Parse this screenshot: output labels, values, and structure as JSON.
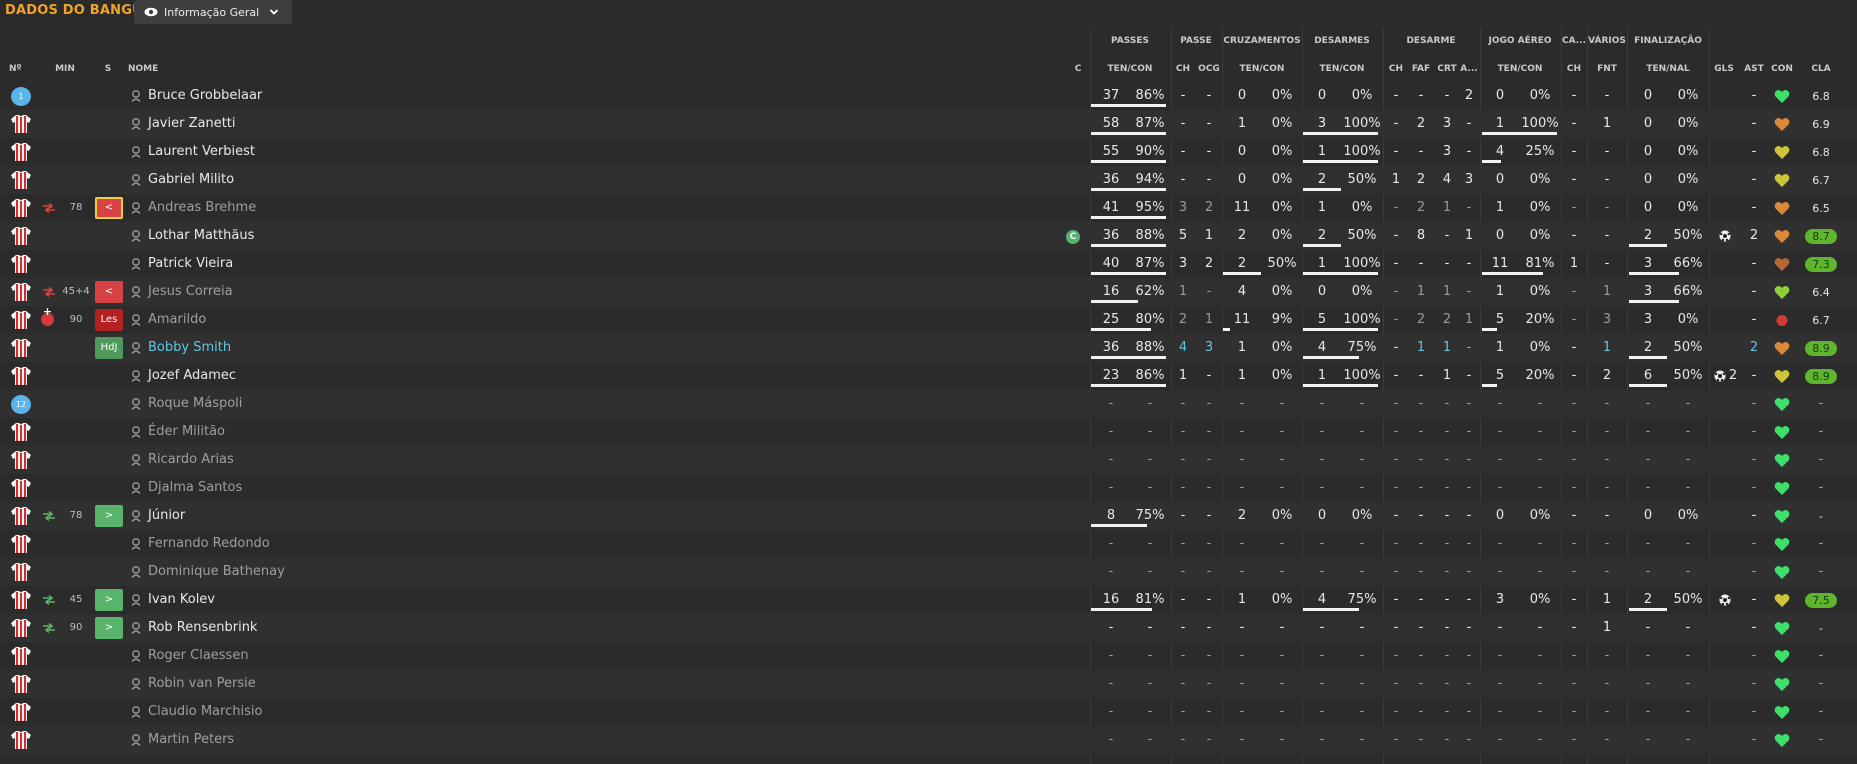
{
  "header": {
    "team_title": "DADOS DO BANGU",
    "view_label": "Informação Geral"
  },
  "columns": {
    "groups": {
      "passes": "PASSES",
      "passe": "PASSE",
      "cruzamentos": "CRUZAMENTOS",
      "desarmes": "DESARMES",
      "desarme": "DESARME",
      "jogo_aereo": "JOGO AÉREO",
      "ca": "CA...",
      "varios": "VÁRIOS",
      "finalizacao": "FINALIZAÇÃO"
    },
    "sub": {
      "num": "Nº",
      "min": "MIN",
      "s": "S",
      "nome": "NOME",
      "c": "C",
      "passes": "TEN/CON",
      "pch": "CH",
      "pocg": "OCG",
      "cruz": "TEN/CON",
      "des": "TEN/CON",
      "dch": "CH",
      "faf": "FAF",
      "crt": "CRT",
      "da": "A...",
      "aer": "TEN/CON",
      "cach": "CH",
      "fnt": "FNT",
      "fin": "TEN/NAL",
      "gls": "GLS",
      "ast": "AST",
      "con": "CON",
      "cla": "CLA"
    }
  },
  "colors": {
    "accent": "#f0a42a",
    "heart_green": "#3fe06a",
    "heart_orange": "#d88a3a",
    "heart_yellow": "#c9c63a",
    "heart_red": "#d33b3b",
    "rating_good": "#5fb52f"
  },
  "players": [
    {
      "name": "Bruce Grobbelaar",
      "gk": "1",
      "min": "",
      "badge": null,
      "sub": null,
      "cap": false,
      "dim": false,
      "hl": false,
      "p": [
        "37",
        "86%"
      ],
      "pch": "-",
      "pocg": "-",
      "cr": [
        "0",
        "0%"
      ],
      "de": [
        "0",
        "0%"
      ],
      "dch": "-",
      "faf": "-",
      "crt": "-",
      "da": "2",
      "ae": [
        "0",
        "0%"
      ],
      "cach": "-",
      "fnt": "-",
      "fi": [
        "0",
        "0%"
      ],
      "gls": "",
      "ast": "-",
      "con": "green",
      "cla": "6.8",
      "good": false,
      "pf": 1.0,
      "crf": 0,
      "def": 0,
      "aef": 0,
      "fif": 0
    },
    {
      "name": "Javier Zanetti",
      "gk": "",
      "min": "",
      "badge": null,
      "sub": null,
      "cap": false,
      "dim": false,
      "hl": false,
      "p": [
        "58",
        "87%"
      ],
      "pch": "-",
      "pocg": "-",
      "cr": [
        "1",
        "0%"
      ],
      "de": [
        "3",
        "100%"
      ],
      "dch": "-",
      "faf": "2",
      "crt": "3",
      "da": "-",
      "ae": [
        "1",
        "100%"
      ],
      "cach": "-",
      "fnt": "1",
      "fi": [
        "0",
        "0%"
      ],
      "gls": "",
      "ast": "-",
      "con": "orange",
      "cla": "6.9",
      "good": false,
      "pf": 1.0,
      "crf": 0,
      "def": 1,
      "aef": 1,
      "fif": 0
    },
    {
      "name": "Laurent Verbiest",
      "gk": "",
      "min": "",
      "badge": null,
      "sub": null,
      "cap": false,
      "dim": false,
      "hl": false,
      "p": [
        "55",
        "90%"
      ],
      "pch": "-",
      "pocg": "-",
      "cr": [
        "0",
        "0%"
      ],
      "de": [
        "1",
        "100%"
      ],
      "dch": "-",
      "faf": "-",
      "crt": "3",
      "da": "-",
      "ae": [
        "4",
        "25%"
      ],
      "cach": "-",
      "fnt": "-",
      "fi": [
        "0",
        "0%"
      ],
      "gls": "",
      "ast": "-",
      "con": "yellow",
      "cla": "6.8",
      "good": false,
      "pf": 1.0,
      "crf": 0,
      "def": 1,
      "aef": 0.25,
      "fif": 0
    },
    {
      "name": "Gabriel Milito",
      "gk": "",
      "min": "",
      "badge": null,
      "sub": null,
      "cap": false,
      "dim": false,
      "hl": false,
      "p": [
        "36",
        "94%"
      ],
      "pch": "-",
      "pocg": "-",
      "cr": [
        "0",
        "0%"
      ],
      "de": [
        "2",
        "50%"
      ],
      "dch": "1",
      "faf": "2",
      "crt": "4",
      "da": "3",
      "ae": [
        "0",
        "0%"
      ],
      "cach": "-",
      "fnt": "-",
      "fi": [
        "0",
        "0%"
      ],
      "gls": "",
      "ast": "-",
      "con": "yellow",
      "cla": "6.7",
      "good": false,
      "pf": 1.0,
      "crf": 0,
      "def": 0.5,
      "aef": 0,
      "fif": 0
    },
    {
      "name": "Andreas Brehme",
      "gk": "",
      "min": "78",
      "badge": "out-sel",
      "sub": "off",
      "cap": false,
      "dim": true,
      "hl": false,
      "p": [
        "41",
        "95%"
      ],
      "pch": "3",
      "pocg": "2",
      "cr": [
        "11",
        "0%"
      ],
      "de": [
        "1",
        "0%"
      ],
      "dch": "-",
      "faf": "2",
      "crt": "1",
      "da": "-",
      "ae": [
        "1",
        "0%"
      ],
      "cach": "-",
      "fnt": "-",
      "fi": [
        "0",
        "0%"
      ],
      "gls": "",
      "ast": "-",
      "con": "orange",
      "cla": "6.5",
      "good": false,
      "pf": 1.0,
      "crf": 0,
      "def": 0,
      "aef": 0,
      "fif": 0
    },
    {
      "name": "Lothar Matthäus",
      "gk": "",
      "min": "",
      "badge": null,
      "sub": null,
      "cap": true,
      "dim": false,
      "hl": false,
      "p": [
        "36",
        "88%"
      ],
      "pch": "5",
      "pocg": "1",
      "cr": [
        "2",
        "0%"
      ],
      "de": [
        "2",
        "50%"
      ],
      "dch": "-",
      "faf": "8",
      "crt": "-",
      "da": "1",
      "ae": [
        "0",
        "0%"
      ],
      "cach": "-",
      "fnt": "-",
      "fi": [
        "2",
        "50%"
      ],
      "gls": "ball",
      "ast": "2",
      "con": "orange",
      "cla": "8.7",
      "good": true,
      "pf": 1.0,
      "crf": 0,
      "def": 0.5,
      "aef": 0,
      "fif": 0.5
    },
    {
      "name": "Patrick Vieira",
      "gk": "",
      "min": "",
      "badge": null,
      "sub": null,
      "cap": false,
      "dim": false,
      "hl": false,
      "p": [
        "40",
        "87%"
      ],
      "pch": "3",
      "pocg": "2",
      "cr": [
        "2",
        "50%"
      ],
      "de": [
        "1",
        "100%"
      ],
      "dch": "-",
      "faf": "-",
      "crt": "-",
      "da": "-",
      "ae": [
        "11",
        "81%"
      ],
      "cach": "1",
      "fnt": "-",
      "fi": [
        "3",
        "66%"
      ],
      "gls": "",
      "ast": "-",
      "con": "brown",
      "cla": "7.3",
      "good": true,
      "pf": 1.0,
      "crf": 0.5,
      "def": 1,
      "aef": 0.81,
      "fif": 0.66
    },
    {
      "name": "Jesus Correia",
      "gk": "",
      "min": "45+4",
      "badge": "out",
      "sub": "off",
      "cap": false,
      "dim": true,
      "hl": false,
      "p": [
        "16",
        "62%"
      ],
      "pch": "1",
      "pocg": "-",
      "cr": [
        "4",
        "0%"
      ],
      "de": [
        "0",
        "0%"
      ],
      "dch": "-",
      "faf": "1",
      "crt": "1",
      "da": "-",
      "ae": [
        "1",
        "0%"
      ],
      "cach": "-",
      "fnt": "1",
      "fi": [
        "3",
        "66%"
      ],
      "gls": "",
      "ast": "-",
      "con": "yellowgreen",
      "cla": "6.4",
      "good": false,
      "pf": 0.62,
      "crf": 0,
      "def": 0,
      "aef": 0,
      "fif": 0.66
    },
    {
      "name": "Amarildo",
      "gk": "",
      "min": "90",
      "badge": "inj",
      "sub": "inj",
      "cap": false,
      "dim": true,
      "hl": false,
      "p": [
        "25",
        "80%"
      ],
      "pch": "2",
      "pocg": "1",
      "cr": [
        "11",
        "9%"
      ],
      "de": [
        "5",
        "100%"
      ],
      "dch": "-",
      "faf": "2",
      "crt": "2",
      "da": "1",
      "ae": [
        "5",
        "20%"
      ],
      "cach": "-",
      "fnt": "3",
      "fi": [
        "3",
        "0%"
      ],
      "gls": "",
      "ast": "-",
      "con": "red",
      "cla": "6.7",
      "good": false,
      "pf": 0.8,
      "crf": 0.09,
      "def": 1,
      "aef": 0.2,
      "fif": 0
    },
    {
      "name": "Bobby Smith",
      "gk": "",
      "min": "",
      "badge": "hdj",
      "sub": null,
      "cap": false,
      "dim": false,
      "hl": true,
      "p": [
        "36",
        "88%"
      ],
      "pch": "4",
      "pocg": "3",
      "cr": [
        "1",
        "0%"
      ],
      "de": [
        "4",
        "75%"
      ],
      "dch": "-",
      "faf": "1",
      "crt": "1",
      "da": "-",
      "ae": [
        "1",
        "0%"
      ],
      "cach": "-",
      "fnt": "1",
      "fi": [
        "2",
        "50%"
      ],
      "gls": "",
      "ast": "2",
      "con": "orange",
      "cla": "8.9",
      "good": true,
      "pf": 1.0,
      "crf": 0,
      "def": 0.75,
      "aef": 0,
      "fif": 0.5
    },
    {
      "name": "Jozef Adamec",
      "gk": "",
      "min": "",
      "badge": null,
      "sub": null,
      "cap": false,
      "dim": false,
      "hl": false,
      "p": [
        "23",
        "86%"
      ],
      "pch": "1",
      "pocg": "-",
      "cr": [
        "1",
        "0%"
      ],
      "de": [
        "1",
        "100%"
      ],
      "dch": "-",
      "faf": "-",
      "crt": "1",
      "da": "-",
      "ae": [
        "5",
        "20%"
      ],
      "cach": "-",
      "fnt": "2",
      "fi": [
        "6",
        "50%"
      ],
      "gls": "ball2",
      "ast": "-",
      "con": "yellow",
      "cla": "8.9",
      "good": true,
      "pf": 1.0,
      "crf": 0,
      "def": 1,
      "aef": 0.2,
      "fif": 0.5
    },
    {
      "name": "Roque Máspoli",
      "gk": "12",
      "min": "",
      "badge": null,
      "sub": null,
      "cap": false,
      "dim": true,
      "hl": false,
      "empty": true,
      "con": "green"
    },
    {
      "name": "Éder Militão",
      "gk": "",
      "min": "",
      "badge": null,
      "sub": null,
      "cap": false,
      "dim": true,
      "hl": false,
      "empty": true,
      "con": "green"
    },
    {
      "name": "Ricardo Arias",
      "gk": "",
      "min": "",
      "badge": null,
      "sub": null,
      "cap": false,
      "dim": true,
      "hl": false,
      "empty": true,
      "con": "green"
    },
    {
      "name": "Djalma Santos",
      "gk": "",
      "min": "",
      "badge": null,
      "sub": null,
      "cap": false,
      "dim": true,
      "hl": false,
      "empty": true,
      "con": "green"
    },
    {
      "name": "Júnior",
      "gk": "",
      "min": "78",
      "badge": "in",
      "sub": "on",
      "cap": false,
      "dim": false,
      "hl": false,
      "p": [
        "8",
        "75%"
      ],
      "pch": "-",
      "pocg": "-",
      "cr": [
        "2",
        "0%"
      ],
      "de": [
        "0",
        "0%"
      ],
      "dch": "-",
      "faf": "-",
      "crt": "-",
      "da": "-",
      "ae": [
        "0",
        "0%"
      ],
      "cach": "-",
      "fnt": "-",
      "fi": [
        "0",
        "0%"
      ],
      "gls": "",
      "ast": "-",
      "con": "green",
      "cla": "-",
      "good": false,
      "pf": 0.75,
      "crf": 0,
      "def": 0,
      "aef": 0,
      "fif": 0
    },
    {
      "name": "Fernando Redondo",
      "gk": "",
      "min": "",
      "badge": null,
      "sub": null,
      "cap": false,
      "dim": true,
      "hl": false,
      "empty": true,
      "con": "green"
    },
    {
      "name": "Dominique Bathenay",
      "gk": "",
      "min": "",
      "badge": null,
      "sub": null,
      "cap": false,
      "dim": true,
      "hl": false,
      "empty": true,
      "con": "green"
    },
    {
      "name": "Ivan Kolev",
      "gk": "",
      "min": "45",
      "badge": "in",
      "sub": "on",
      "cap": false,
      "dim": false,
      "hl": false,
      "p": [
        "16",
        "81%"
      ],
      "pch": "-",
      "pocg": "-",
      "cr": [
        "1",
        "0%"
      ],
      "de": [
        "4",
        "75%"
      ],
      "dch": "-",
      "faf": "-",
      "crt": "-",
      "da": "-",
      "ae": [
        "3",
        "0%"
      ],
      "cach": "-",
      "fnt": "1",
      "fi": [
        "2",
        "50%"
      ],
      "gls": "ball",
      "ast": "-",
      "con": "yellow",
      "cla": "7.5",
      "good": true,
      "pf": 0.81,
      "crf": 0,
      "def": 0.75,
      "aef": 0,
      "fif": 0.5
    },
    {
      "name": "Rob Rensenbrink",
      "gk": "",
      "min": "90",
      "badge": "in",
      "sub": "on",
      "cap": false,
      "dim": false,
      "hl": false,
      "p": [
        "-",
        "-"
      ],
      "pch": "-",
      "pocg": "-",
      "cr": [
        "-",
        "-"
      ],
      "de": [
        "-",
        "-"
      ],
      "dch": "-",
      "faf": "-",
      "crt": "-",
      "da": "-",
      "ae": [
        "-",
        "-"
      ],
      "cach": "-",
      "fnt": "1",
      "fi": [
        "-",
        "-"
      ],
      "gls": "",
      "ast": "-",
      "con": "green",
      "cla": "-",
      "good": false,
      "pf": 0,
      "crf": 0,
      "def": 0,
      "aef": 0,
      "fif": 0
    },
    {
      "name": "Roger Claessen",
      "gk": "",
      "min": "",
      "badge": null,
      "sub": null,
      "cap": false,
      "dim": true,
      "hl": false,
      "empty": true,
      "con": "green"
    },
    {
      "name": "Robin van Persie",
      "gk": "",
      "min": "",
      "badge": null,
      "sub": null,
      "cap": false,
      "dim": true,
      "hl": false,
      "empty": true,
      "con": "green"
    },
    {
      "name": "Claudio Marchisio",
      "gk": "",
      "min": "",
      "badge": null,
      "sub": null,
      "cap": false,
      "dim": true,
      "hl": false,
      "empty": true,
      "con": "green"
    },
    {
      "name": "Martin Peters",
      "gk": "",
      "min": "",
      "badge": null,
      "sub": null,
      "cap": false,
      "dim": true,
      "hl": false,
      "empty": true,
      "con": "green"
    }
  ],
  "badges": {
    "out": "<",
    "in": ">",
    "inj": "Les",
    "hdj": "HdJ"
  }
}
